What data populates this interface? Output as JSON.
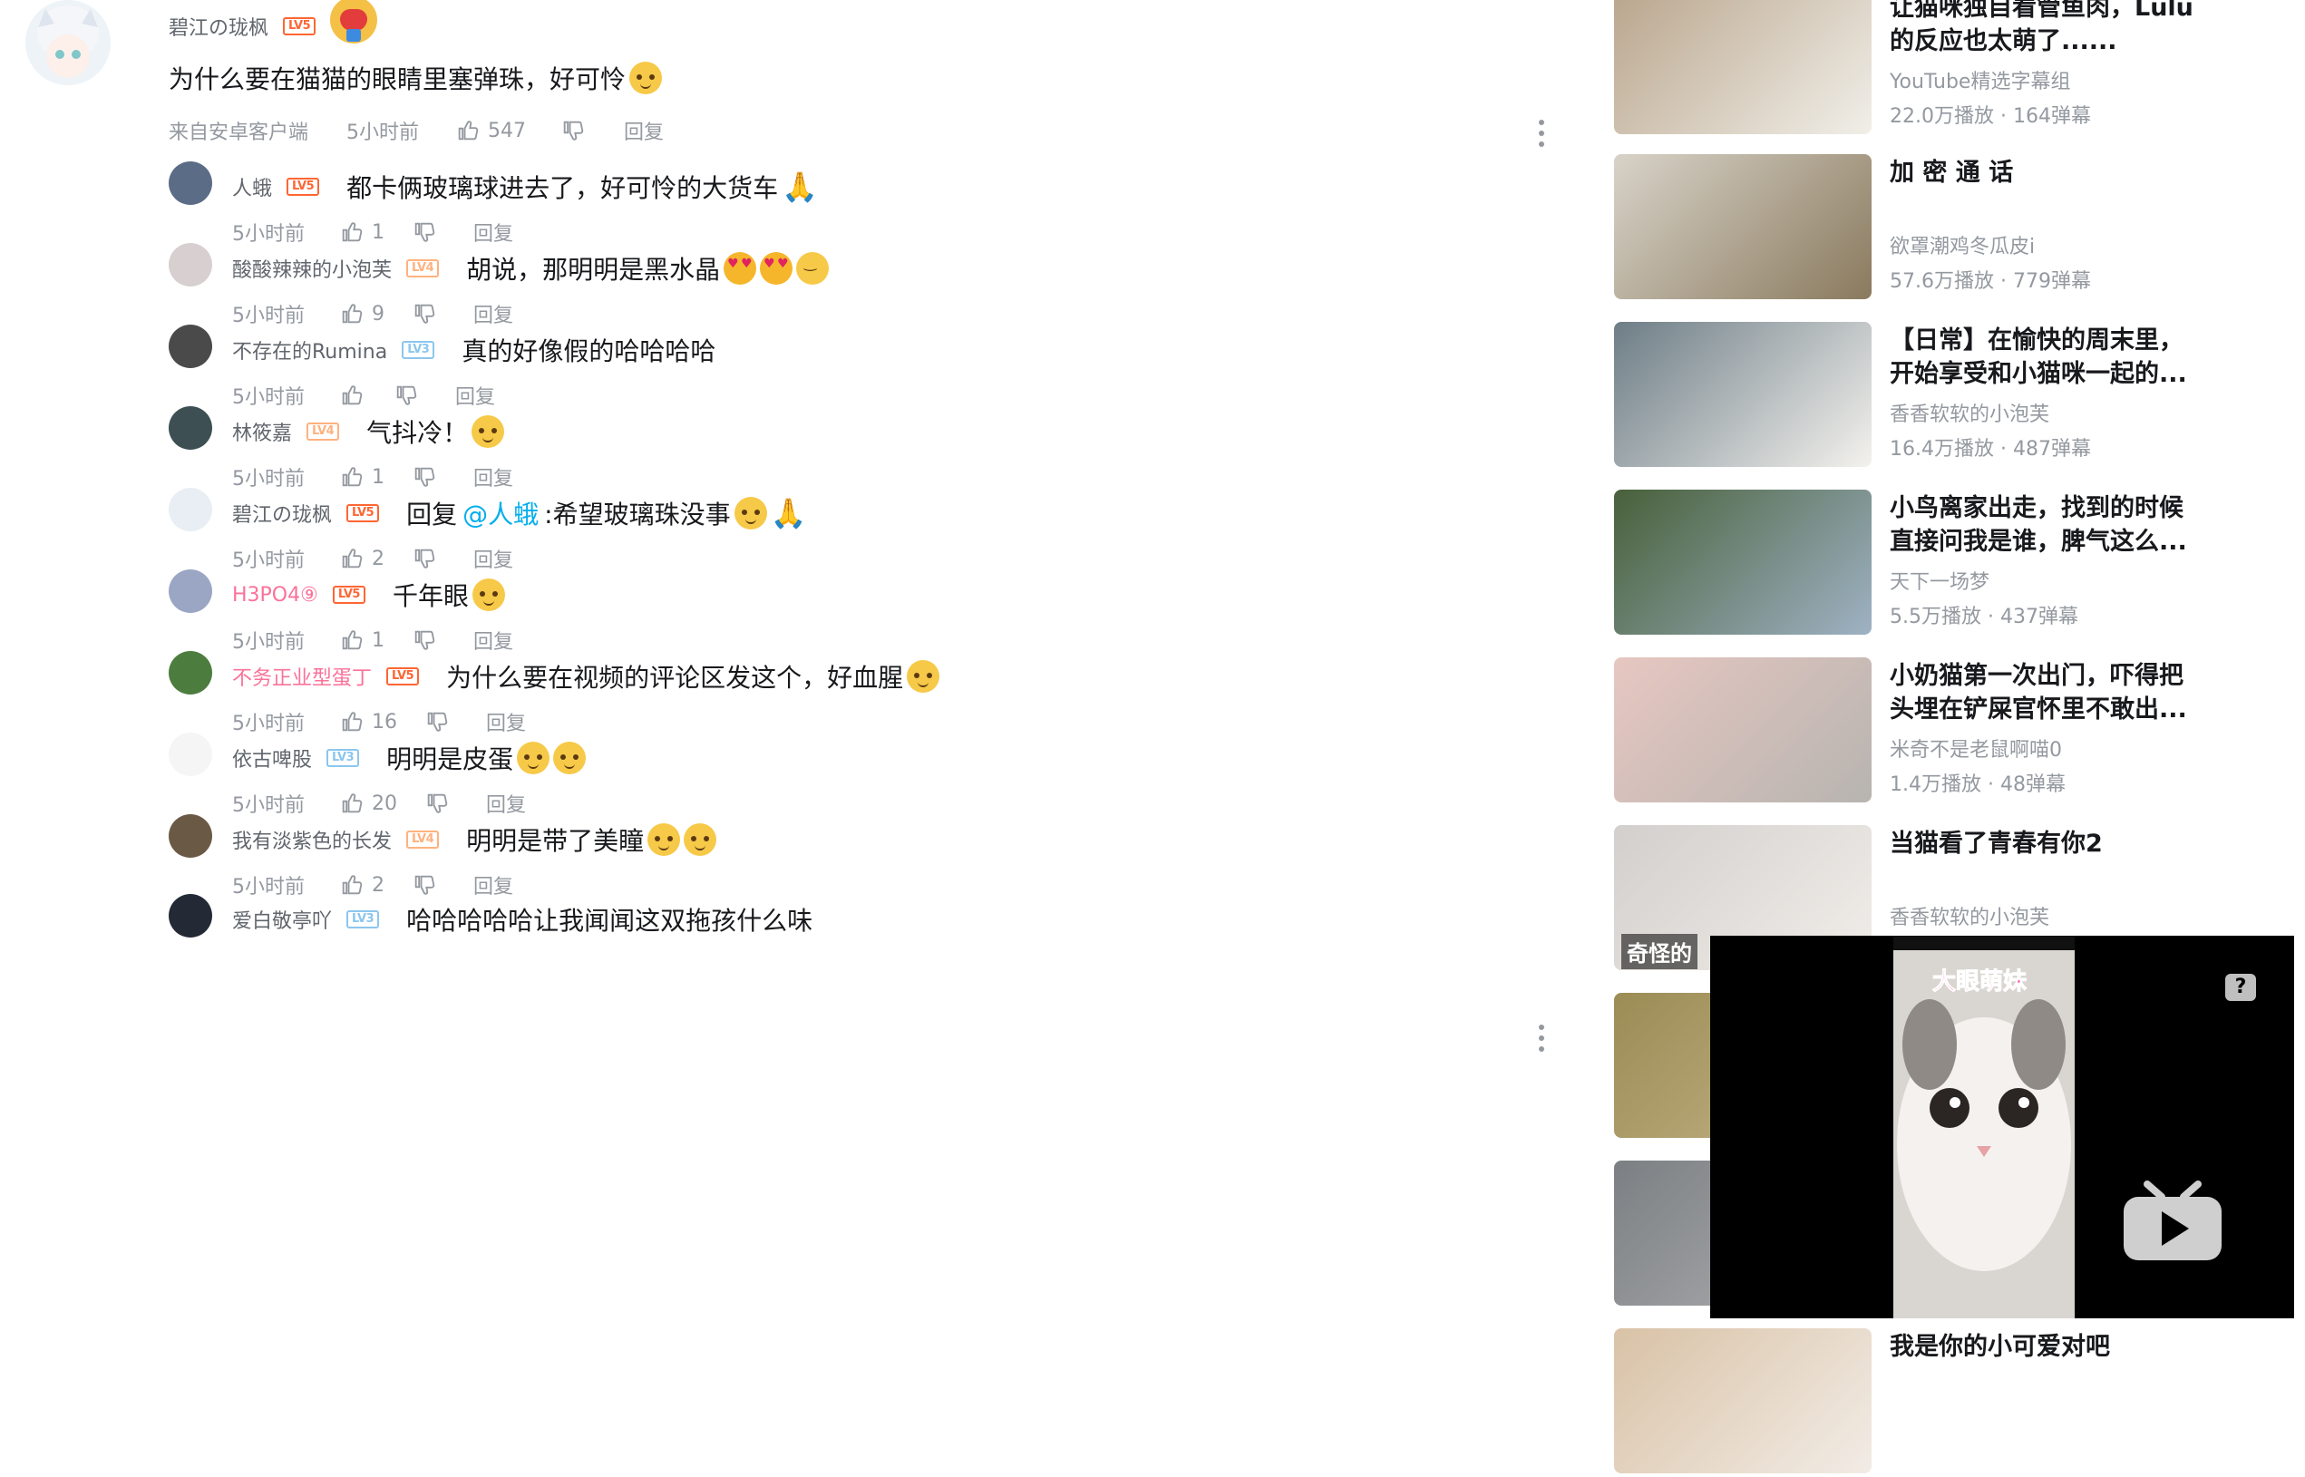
{
  "main_comment": {
    "username": "碧江の珑枫",
    "level": "LV5",
    "text": "为什么要在猫猫的眼睛里塞弹珠，好可怜",
    "source": "来自安卓客户端",
    "time": "5小时前",
    "likes": "547",
    "reply_label": "回复"
  },
  "replies": [
    {
      "username": "人蛾",
      "level": "LV5",
      "text": "都卡俩玻璃球进去了，好可怜的大货车",
      "time": "5小时前",
      "likes": "1",
      "reply_label": "回复",
      "emojis": [
        "pray"
      ]
    },
    {
      "username": "酸酸辣辣的小泡芙",
      "level": "LV4",
      "text": "胡说，那明明是黑水晶",
      "time": "5小时前",
      "likes": "9",
      "reply_label": "回复",
      "emojis": [
        "heart",
        "heart",
        "wink"
      ]
    },
    {
      "username": "不存在的Rumina",
      "level": "LV3",
      "text": "真的好像假的哈哈哈哈",
      "time": "5小时前",
      "likes": "",
      "reply_label": "回复",
      "emojis": []
    },
    {
      "username": "林筱嘉",
      "level": "LV4",
      "text": "气抖冷！",
      "time": "5小时前",
      "likes": "1",
      "reply_label": "回复",
      "emojis": [
        "dog"
      ]
    },
    {
      "username": "碧江の珑枫",
      "level": "LV5",
      "text_prefix": "回复",
      "mention": "@人蛾",
      "text": ":希望玻璃珠没事",
      "time": "5小时前",
      "likes": "2",
      "reply_label": "回复",
      "emojis": [
        "dog",
        "pray"
      ]
    },
    {
      "username": "H3PO4⑨",
      "level": "LV5",
      "text": "千年眼",
      "time": "5小时前",
      "likes": "1",
      "reply_label": "回复",
      "emojis": [
        "dog"
      ],
      "pink": true
    },
    {
      "username": "不务正业型蛋丁",
      "level": "LV5",
      "text": "为什么要在视频的评论区发这个，好血腥",
      "time": "5小时前",
      "likes": "16",
      "reply_label": "回复",
      "emojis": [
        "dog"
      ],
      "pink": true
    },
    {
      "username": "依古啤股",
      "level": "LV3",
      "text": "明明是皮蛋",
      "time": "5小时前",
      "likes": "20",
      "reply_label": "回复",
      "emojis": [
        "dog",
        "dog"
      ]
    },
    {
      "username": "我有淡紫色的长发",
      "level": "LV4",
      "text": "明明是带了美瞳",
      "time": "5小时前",
      "likes": "2",
      "reply_label": "回复",
      "emojis": [
        "dog",
        "dog"
      ]
    },
    {
      "username": "爱白敬亭吖",
      "level": "LV3",
      "text": "哈哈哈哈哈让我闻闻这双拖孩什么味",
      "time": "",
      "likes": "",
      "reply_label": "",
      "emojis": []
    }
  ],
  "sidebar": {
    "cards": [
      {
        "title": "让猫咪独自看管鱼肉，Lulu的反应也太萌了......",
        "author": "YouTube精选字幕组",
        "stats": "22.0万播放 · 164弹幕"
      },
      {
        "title": "加 密 通 话",
        "author": "欲罩潮鸡冬瓜皮i",
        "stats": "57.6万播放 · 779弹幕"
      },
      {
        "title": "【日常】在愉快的周末里，开始享受和小猫咪一起的...",
        "author": "香香软软的小泡芙",
        "stats": "16.4万播放 · 487弹幕"
      },
      {
        "title": "小鸟离家出走，找到的时候直接问我是谁，脾气这么...",
        "author": "天下一场梦",
        "stats": "5.5万播放 · 437弹幕"
      },
      {
        "title": "小奶猫第一次出门，吓得把头埋在铲屎官怀里不敢出...",
        "author": "米奇不是老鼠啊喵0",
        "stats": "1.4万播放 · 48弹幕"
      },
      {
        "title": "当猫看了青春有你2",
        "author": "香香软软的小泡芙",
        "stats": ""
      },
      {
        "title": "",
        "author": "",
        "stats": ""
      },
      {
        "title": "",
        "author": "",
        "stats": ""
      },
      {
        "title": "我是你的小可爱对吧",
        "author": "",
        "stats": ""
      }
    ],
    "overlay_label": "奇怪的"
  },
  "mini_player": {
    "caption": "大眼萌妹",
    "help": "?"
  }
}
